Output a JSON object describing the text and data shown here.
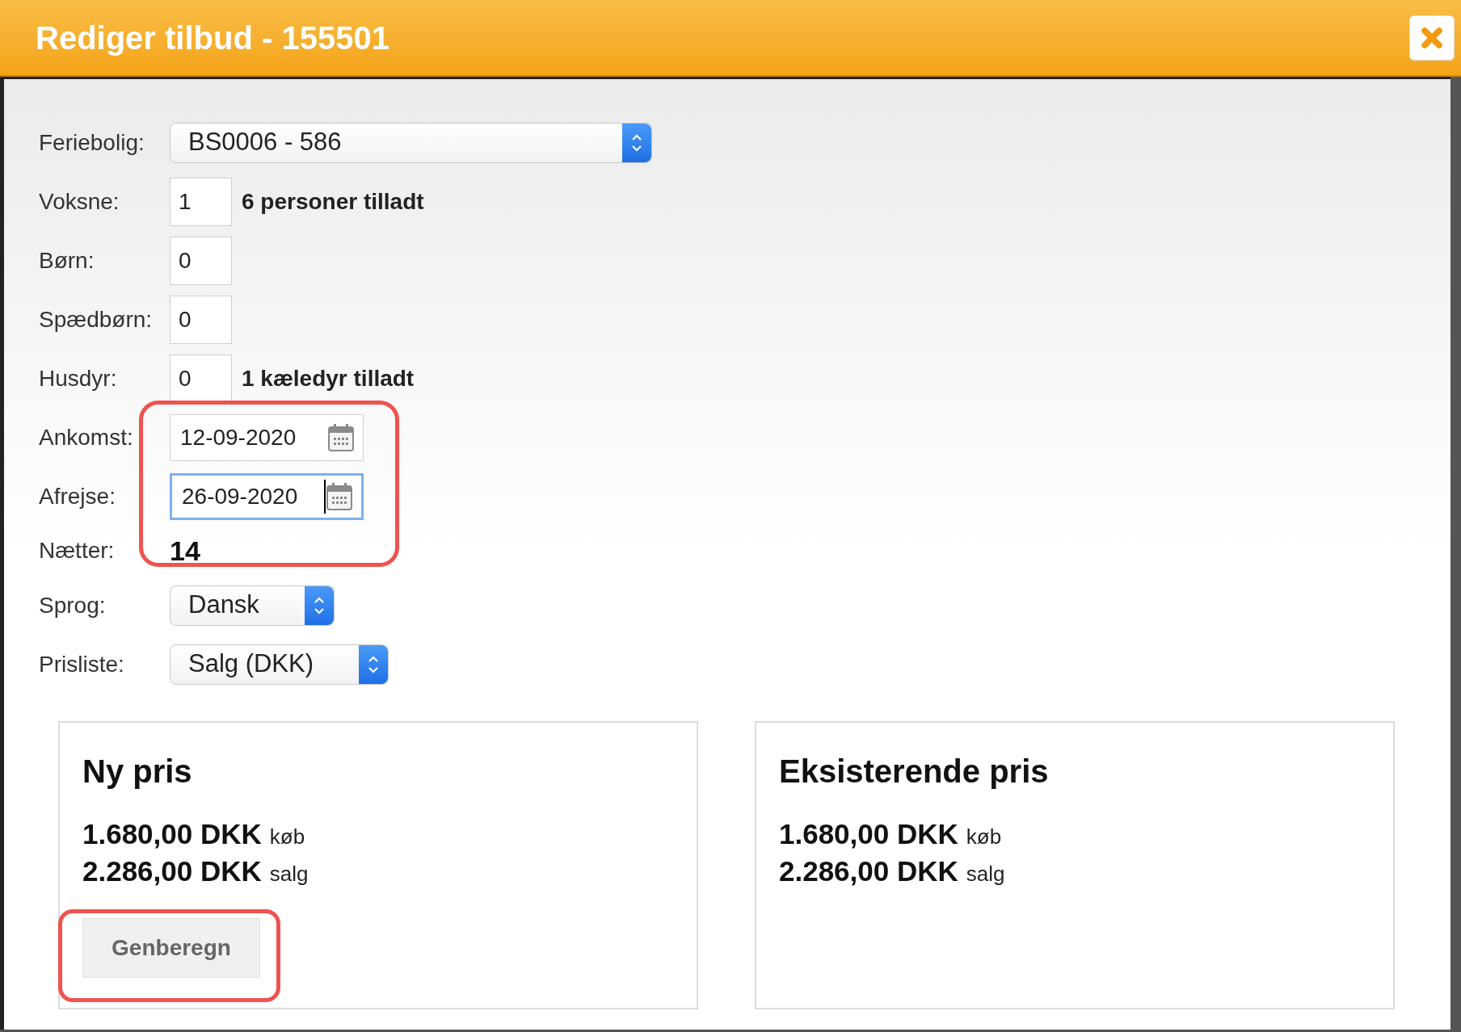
{
  "dialog": {
    "title": "Rediger tilbud - 155501"
  },
  "fields": [
    {
      "kind": "select",
      "label": "Feriebolig:",
      "value": "BS0006 - 586"
    },
    {
      "kind": "number",
      "label": "Voksne:",
      "value": "1",
      "note": "6 personer tilladt"
    },
    {
      "kind": "number",
      "label": "Børn:",
      "value": "0"
    },
    {
      "kind": "number",
      "label": "Spædbørn:",
      "value": "0"
    },
    {
      "kind": "number",
      "label": "Husdyr:",
      "value": "0",
      "note": "1 kæledyr tilladt"
    },
    {
      "kind": "date",
      "label": "Ankomst:",
      "value": "12-09-2020",
      "focused": false
    },
    {
      "kind": "date",
      "label": "Afrejse:",
      "value": "26-09-2020",
      "focused": true
    },
    {
      "kind": "value",
      "label": "Nætter:",
      "value": "14"
    },
    {
      "kind": "select",
      "label": "Sprog:",
      "value": "Dansk"
    },
    {
      "kind": "select",
      "label": "Prisliste:",
      "value": "Salg (DKK)"
    }
  ],
  "price_panels": [
    {
      "title": "Ny pris",
      "lines": [
        {
          "amount": "1.680,00 DKK",
          "unit": "køb"
        },
        {
          "amount": "2.286,00 DKK",
          "unit": "salg"
        }
      ],
      "button": "Genberegn"
    },
    {
      "title": "Eksisterende pris",
      "lines": [
        {
          "amount": "1.680,00 DKK",
          "unit": "køb"
        },
        {
          "amount": "2.286,00 DKK",
          "unit": "salg"
        }
      ]
    }
  ]
}
